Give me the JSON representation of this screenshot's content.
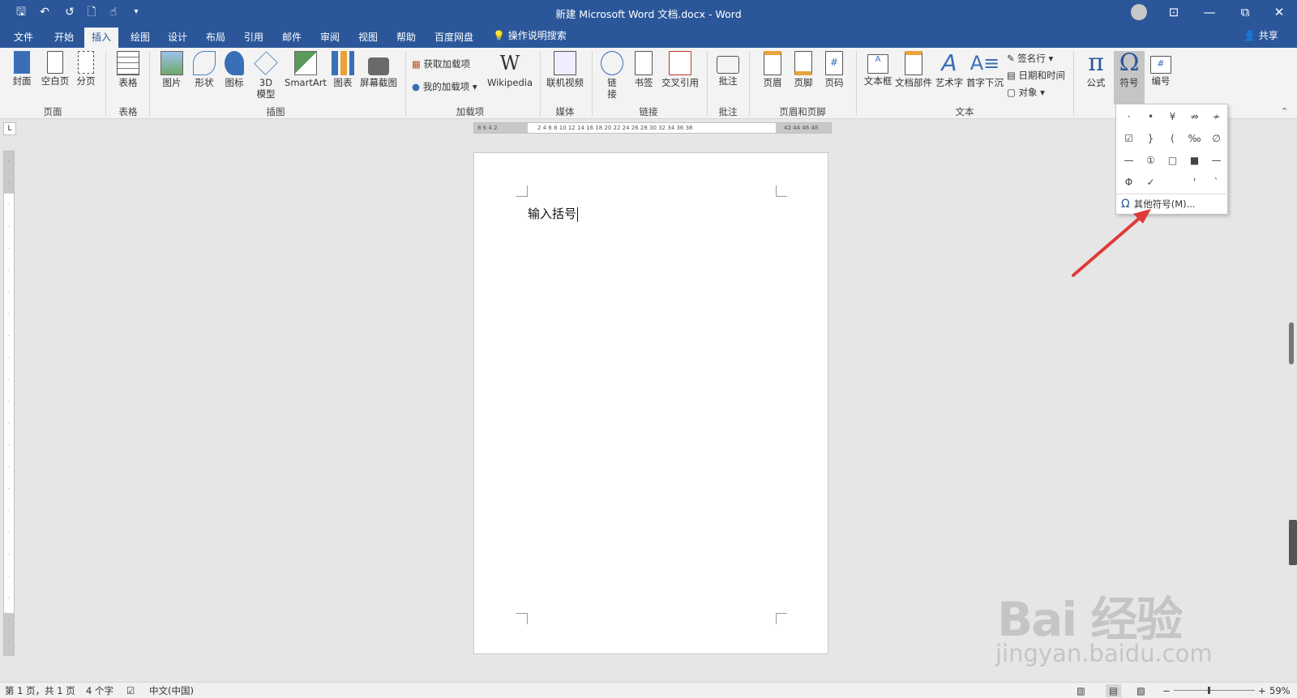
{
  "window": {
    "title": "新建 Microsoft Word 文档.docx  -  Word"
  },
  "qat": {
    "save": "🖫",
    "undo": "↶",
    "redo": "↺",
    "print_preview": "🗋",
    "touch": "☝",
    "customize": "▾"
  },
  "tabs": [
    "文件",
    "开始",
    "插入",
    "绘图",
    "设计",
    "布局",
    "引用",
    "邮件",
    "审阅",
    "视图",
    "帮助",
    "百度网盘"
  ],
  "tell_me": "操作说明搜索",
  "share": "共享",
  "ribbon": {
    "pages": {
      "cover": "封面",
      "blank": "空白页",
      "break": "分页",
      "group": "页面"
    },
    "tables": {
      "table": "表格",
      "group": "表格"
    },
    "illustrations": {
      "picture": "图片",
      "shapes": "形状",
      "icons": "图标",
      "model_a": "3D",
      "model_b": "模型",
      "smartart": "SmartArt",
      "chart": "图表",
      "screenshot": "屏幕截图",
      "group": "插图"
    },
    "addins": {
      "get": "获取加载项",
      "mine": "我的加载项",
      "wikipedia": "Wikipedia",
      "group": "加载项"
    },
    "media": {
      "video": "联机视频",
      "group": "媒体"
    },
    "links": {
      "link_a": "链",
      "link_b": "接",
      "bookmark": "书签",
      "crossref": "交叉引用",
      "group": "链接"
    },
    "comments": {
      "comment": "批注",
      "group": "批注"
    },
    "header_footer": {
      "header": "页眉",
      "footer": "页脚",
      "page_number": "页码",
      "group": "页眉和页脚"
    },
    "text": {
      "textbox": "文本框",
      "quickparts": "文档部件",
      "wordart": "艺术字",
      "dropcap": "首字下沉",
      "signature": "签名行",
      "datetime": "日期和时间",
      "object": "对象",
      "group": "文本"
    },
    "symbols": {
      "equation": "公式",
      "symbol": "符号",
      "number": "编号"
    }
  },
  "ruler": {
    "h_left": "8  6  4  2",
    "h_main": "2  4  6  8  10  12  14  16  18  20  22  24  26  28  30  32  34  36  38",
    "h_right": "42  44  46  48"
  },
  "document": {
    "text": "输入括号"
  },
  "symbol_menu": {
    "symbols": [
      "·",
      "•",
      "¥",
      "⇏",
      "≁",
      "☑",
      "}",
      "(",
      "‰",
      "∅",
      "—",
      "①",
      "□",
      "■",
      "—",
      "Φ",
      "✓",
      "",
      "'",
      "`"
    ],
    "more": "其他符号(M)..."
  },
  "status": {
    "page": "第 1 页，共 1 页",
    "words": "4 个字",
    "language": "中文(中国)",
    "zoom": "59%"
  },
  "watermark": {
    "main": "Bai  经验",
    "sub": "jingyan.baidu.com"
  },
  "colors": {
    "accent": "#2b579a",
    "arrow": "#e03a3a"
  }
}
